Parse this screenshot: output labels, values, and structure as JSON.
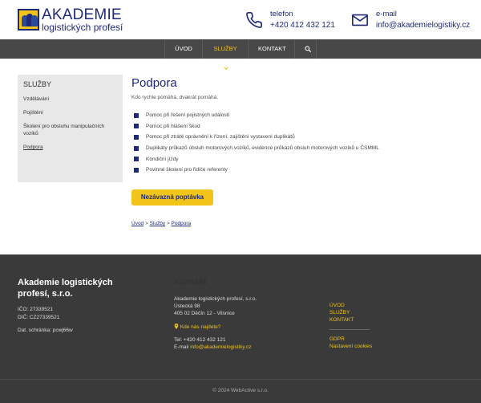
{
  "header": {
    "logo_line1": "AKADEMIE",
    "logo_line2": "logistických profesí",
    "phone_label": "telefon",
    "phone_value": "+420 412 432 121",
    "email_label": "e-mail",
    "email_value": "info@akademielogistiky.cz"
  },
  "nav": {
    "items": [
      "ÚVOD",
      "SLUŽBY",
      "KONTAKT"
    ],
    "active": "SLUŽBY"
  },
  "sidebar": {
    "title": "SLUŽBY",
    "items": [
      "Vzdělávání",
      "Pojištění",
      "Školení pro obsluhu manipulačních vozíků",
      "Podpora"
    ]
  },
  "main": {
    "title": "Podpora",
    "lead": "Kdo rychle pomáhá, dvakrát pomáhá.",
    "list": [
      "Pomoc při řešení pojistných událostí",
      "Pomoc při hlášení škod",
      "Pomoc při ztrátě oprávnění k řízení, zajištění vystavení duplikátů",
      "Duplikáty průkazů obsluh motorových vozíků, evidence průkazů obsluh motorových vozíků u ČSMML",
      "Kondiční jízdy",
      "Povinné školení pro řidiče referenty"
    ],
    "cta": "Nezávazná poptávka",
    "breadcrumb": [
      "Úvod",
      "Služby",
      "Podpora"
    ],
    "breadcrumb_sep": ">"
  },
  "footer": {
    "company": "Akademie logistických profesí, s.r.o.",
    "ico": "IČO: 27339521",
    "dic": "DIČ: CZ27339521",
    "databox": "Dat. schránka: pcwj66w",
    "contact_title": "Kontakt",
    "addr1": "Akademie logistických profesí, s.r.o.",
    "addr2": "Ústecká 98",
    "addr3": "405 02 Děčín 12 - Vilsnice",
    "find_us": "Kde nás najdete?",
    "tel": "Tel: +420 412 432 121",
    "email_prefix": "E-mail ",
    "email": "info@akademielogistiky.cz",
    "links": [
      "ÚVOD",
      "SLUŽBY",
      "KONTAKT"
    ],
    "links2": [
      "GDPR",
      "Nastavení cookies"
    ],
    "copyright": "© 2024  WebActive s.r.o."
  },
  "colors": {
    "brand_blue": "#1e2a78",
    "brand_yellow": "#f2c318",
    "nav_bg": "#484848",
    "footer_bg": "#3a3a3a"
  }
}
